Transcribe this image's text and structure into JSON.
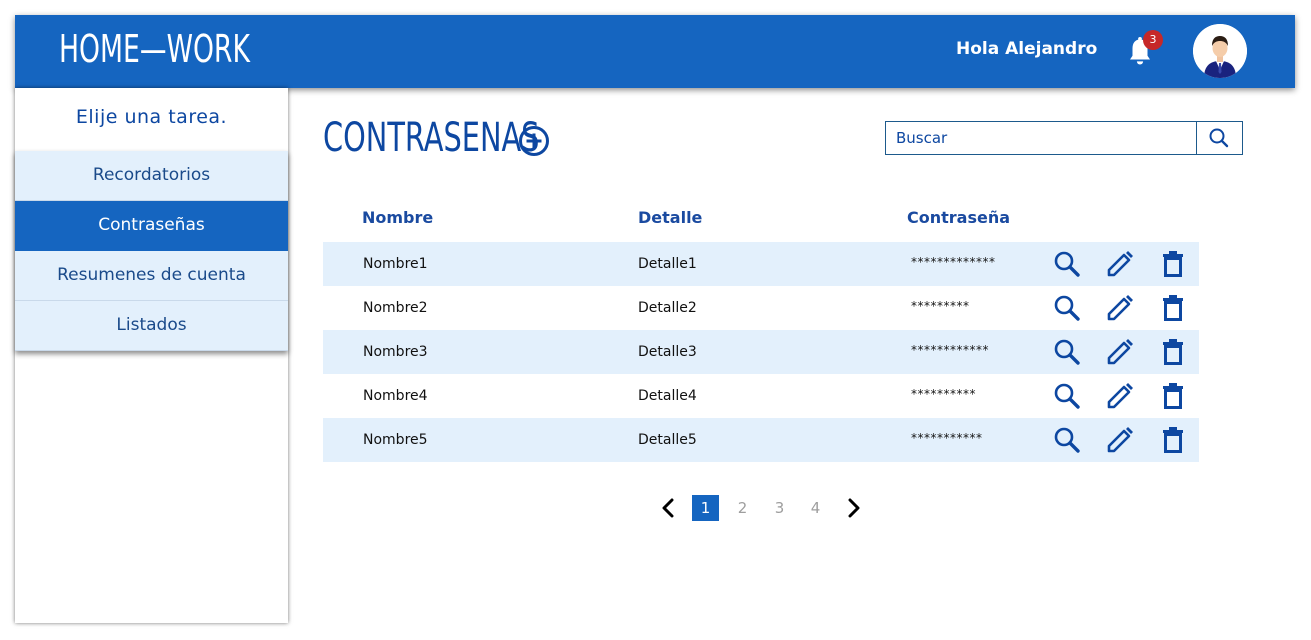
{
  "header": {
    "logo": "HOME—WORK",
    "greeting": "Hola Alejandro",
    "notification_count": "3",
    "icons": {
      "bell": "bell-icon",
      "avatar": "avatar"
    },
    "colors": {
      "bar": "#1565c0",
      "badge": "#c62828"
    }
  },
  "sidebar": {
    "title": "Elije una tarea.",
    "items": [
      {
        "label": "Recordatorios",
        "active": false
      },
      {
        "label": "Contraseñas",
        "active": true
      },
      {
        "label": "Resumenes de cuenta",
        "active": false
      },
      {
        "label": "Listados",
        "active": false
      }
    ]
  },
  "main": {
    "title": "CONTRASENAS",
    "add_icon": "plus-circle-icon",
    "search": {
      "placeholder": "Buscar",
      "icon": "search-icon"
    },
    "table": {
      "columns": [
        "Nombre",
        "Detalle",
        "Contraseña"
      ],
      "rows": [
        {
          "nombre": "Nombre1",
          "detalle": "Detalle1",
          "password": "*************"
        },
        {
          "nombre": "Nombre2",
          "detalle": "Detalle2",
          "password": "*********"
        },
        {
          "nombre": "Nombre3",
          "detalle": "Detalle3",
          "password": "************"
        },
        {
          "nombre": "Nombre4",
          "detalle": "Detalle4",
          "password": "**********"
        },
        {
          "nombre": "Nombre5",
          "detalle": "Detalle5",
          "password": "***********"
        }
      ],
      "row_actions": [
        "view-icon",
        "edit-icon",
        "delete-icon"
      ]
    },
    "pagination": {
      "pages": [
        "1",
        "2",
        "3",
        "4"
      ],
      "current": "1",
      "prev_icon": "chevron-left-icon",
      "next_icon": "chevron-right-icon"
    }
  }
}
